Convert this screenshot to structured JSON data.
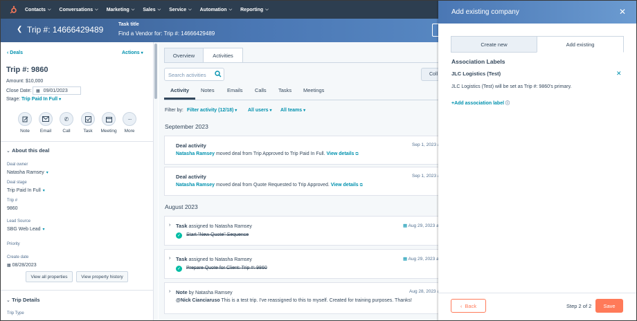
{
  "topnav": {
    "items": [
      "Contacts",
      "Conversations",
      "Marketing",
      "Sales",
      "Service",
      "Automation",
      "Reporting"
    ]
  },
  "subheader": {
    "record_title": "Trip #: 14666429489",
    "task_label": "Task title",
    "task_value": "Find a Vendor for: Trip #: 14666429489"
  },
  "left": {
    "back_link": "Deals",
    "actions_label": "Actions",
    "deal_name": "Trip #: 9860",
    "amount": "Amount: $10,000",
    "close_date_label": "Close Date:",
    "close_date_value": "09/01/2023",
    "stage_label": "Stage:",
    "stage_value": "Trip Paid In Full",
    "activity_buttons": [
      "Note",
      "Email",
      "Call",
      "Task",
      "Meeting",
      "More"
    ],
    "about_title": "About this deal",
    "properties": [
      {
        "label": "Deal owner",
        "value": "Natasha Ramsey"
      },
      {
        "label": "Deal stage",
        "value": "Trip Paid In Full"
      },
      {
        "label": "Trip #",
        "value": "9860"
      },
      {
        "label": "Lead Source",
        "value": "SBG Web Lead"
      },
      {
        "label": "Priority",
        "value": ""
      },
      {
        "label": "Create date",
        "value": "08/28/2023"
      }
    ],
    "view_all_btn": "View all properties",
    "view_history_btn": "View property history",
    "trip_details_title": "Trip Details",
    "trip_type_label": "Trip Type"
  },
  "middle": {
    "tabs": [
      "Overview",
      "Activities"
    ],
    "search_placeholder": "Search activities",
    "partial_button": "Coll",
    "subtabs": [
      "Activity",
      "Notes",
      "Emails",
      "Calls",
      "Tasks",
      "Meetings"
    ],
    "filter_by": "Filter by:",
    "filter_activity": "Filter activity (12/18)",
    "all_users": "All users",
    "all_teams": "All teams",
    "month1": "September 2023",
    "month2": "August 2023",
    "cards": [
      {
        "title": "Deal activity",
        "date": "Sep 1, 2023 at",
        "user": "Natasha Ramsey",
        "text": " moved deal from Trip Approved to Trip Paid In Full. ",
        "link": "View details"
      },
      {
        "title": "Deal activity",
        "date": "Sep 1, 2023 at",
        "user": "Natasha Ramsey",
        "text": " moved deal from Quote Requested to Trip Approved. ",
        "link": "View details"
      }
    ],
    "tasks": [
      {
        "title": "Task",
        "assigned": " assigned to Natasha Ramsey",
        "date": "Aug 29, 2023 at",
        "body": "Start \"New Quote\" Sequence"
      },
      {
        "title": "Task",
        "assigned": " assigned to Natasha Ramsey",
        "date": "Aug 29, 2023 at",
        "body": "Prepare Quote for Client: Trip #: 9860"
      }
    ],
    "note": {
      "title": "Note",
      "by": " by Natasha Ramsey",
      "date": "Aug 28, 2023 at",
      "mention": "@Nick Cianciaruso",
      "body": " This is a test trip. I've reassigned to this to myself. Created for training purposes. Thanks!"
    }
  },
  "panel": {
    "title": "Add existing company",
    "tab_create": "Create new",
    "tab_existing": "Add existing",
    "assoc_labels": "Association Labels",
    "company": "JLC Logistics (Test)",
    "primary_note": "JLC Logistics (Test) will be set as Trip #: 9860's primary.",
    "add_label_link": "+Add association label",
    "back_btn": "Back",
    "step": "Step 2 of 2",
    "save_btn": "Save"
  },
  "colors": {
    "nav": "#2d3e50",
    "link": "#0091ae",
    "accent": "#ff7a59",
    "success": "#00bda5"
  }
}
